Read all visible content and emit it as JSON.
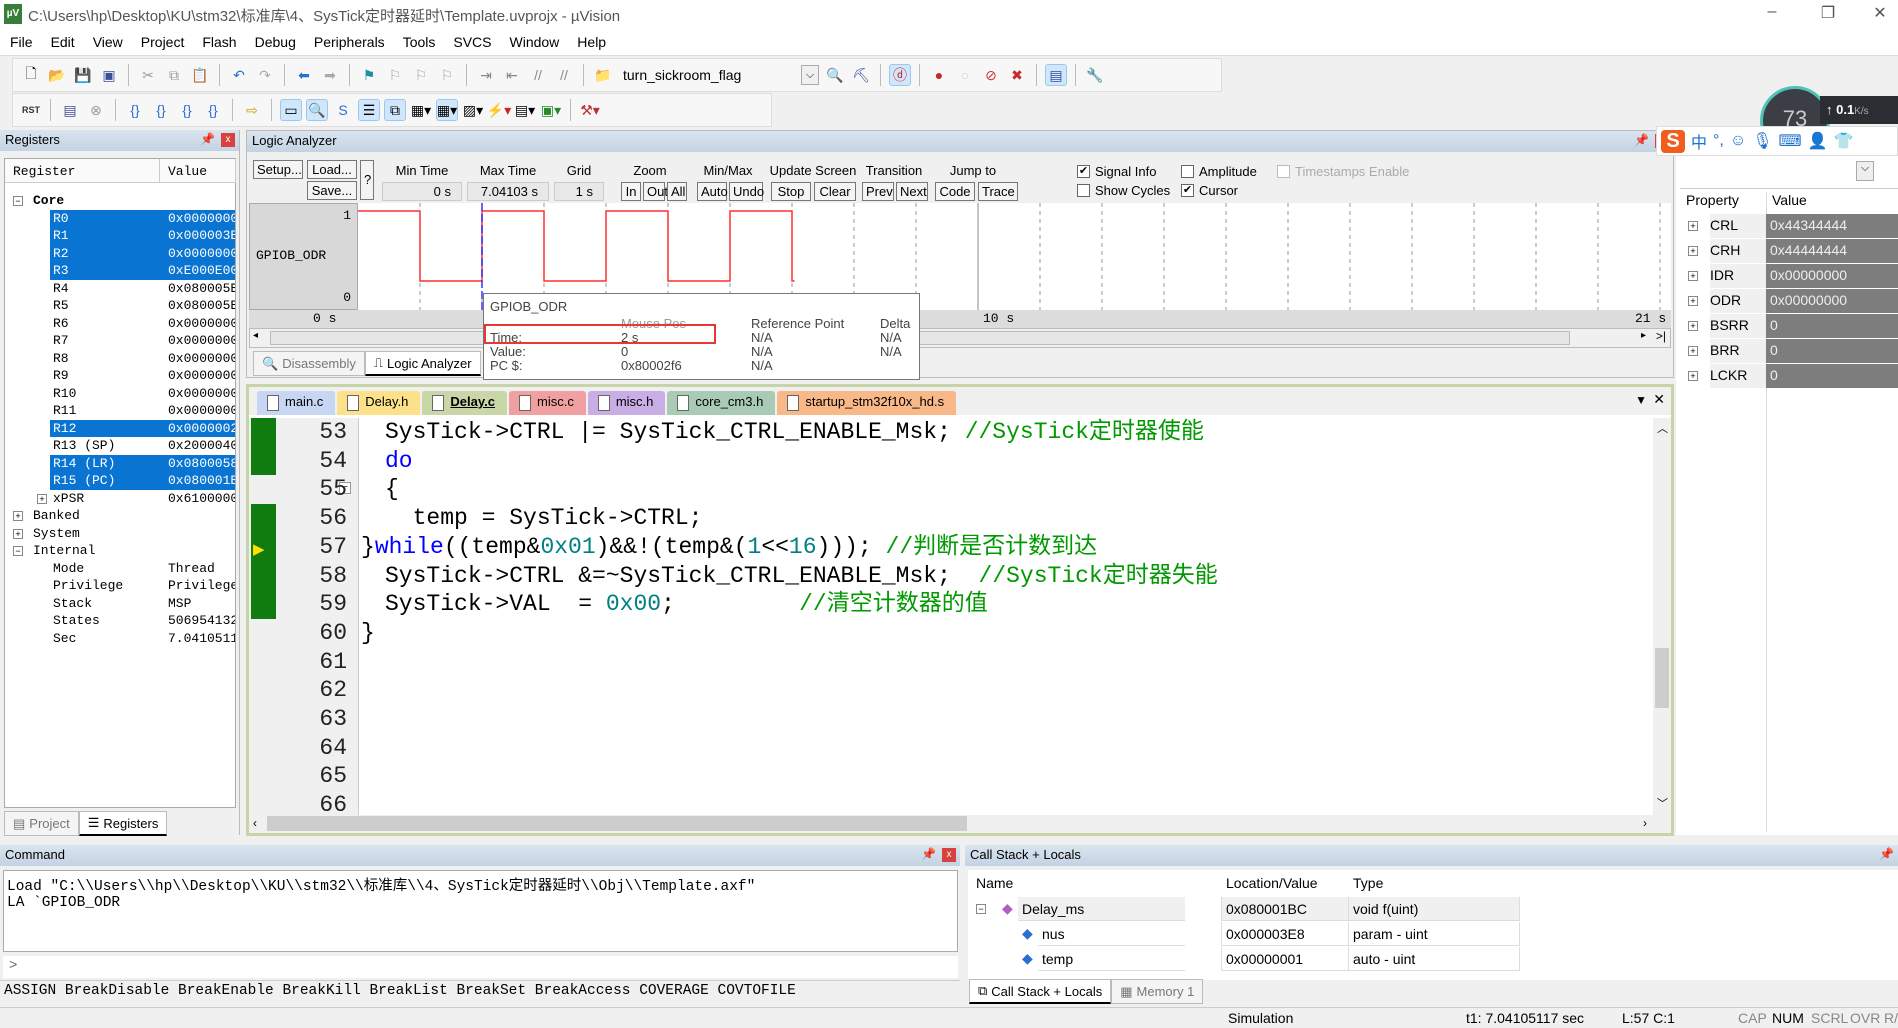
{
  "window": {
    "title": "C:\\Users\\hp\\Desktop\\KU\\stm32\\标准库\\4、SysTick定时器延时\\Template.uvprojx - µVision",
    "app_icon": "uv"
  },
  "menu": [
    "File",
    "Edit",
    "View",
    "Project",
    "Flash",
    "Debug",
    "Peripherals",
    "Tools",
    "SVCS",
    "Window",
    "Help"
  ],
  "toolbar": {
    "find_value": "turn_sickroom_flag",
    "rst_label": "RST"
  },
  "registers": {
    "title": "Registers",
    "col_register": "Register",
    "col_value": "Value",
    "rows": [
      {
        "name": "Core",
        "value": "",
        "level": 0,
        "toggle": "−",
        "bold": true,
        "sel": false
      },
      {
        "name": "R0",
        "value": "0x0000000",
        "level": 1,
        "sel": true
      },
      {
        "name": "R1",
        "value": "0x000003E",
        "level": 1,
        "sel": true
      },
      {
        "name": "R2",
        "value": "0x0000000",
        "level": 1,
        "sel": true
      },
      {
        "name": "R3",
        "value": "0xE000E00",
        "level": 1,
        "sel": true
      },
      {
        "name": "R4",
        "value": "0x080005B",
        "level": 1,
        "sel": false
      },
      {
        "name": "R5",
        "value": "0x080005B",
        "level": 1,
        "sel": false
      },
      {
        "name": "R6",
        "value": "0x0000000",
        "level": 1,
        "sel": false
      },
      {
        "name": "R7",
        "value": "0x0000000",
        "level": 1,
        "sel": false
      },
      {
        "name": "R8",
        "value": "0x0000000",
        "level": 1,
        "sel": false
      },
      {
        "name": "R9",
        "value": "0x0000000",
        "level": 1,
        "sel": false
      },
      {
        "name": "R10",
        "value": "0x0000000",
        "level": 1,
        "sel": false
      },
      {
        "name": "R11",
        "value": "0x0000000",
        "level": 1,
        "sel": false
      },
      {
        "name": "R12",
        "value": "0x0000002",
        "level": 1,
        "sel": true
      },
      {
        "name": "R13 (SP)",
        "value": "0x2000040",
        "level": 1,
        "sel": false
      },
      {
        "name": "R14 (LR)",
        "value": "0x0800058",
        "level": 1,
        "sel": true
      },
      {
        "name": "R15 (PC)",
        "value": "0x080001B",
        "level": 1,
        "sel": true
      },
      {
        "name": "xPSR",
        "value": "0x6100000",
        "level": 1,
        "toggle": "+",
        "sel": false
      },
      {
        "name": "Banked",
        "value": "",
        "level": 0,
        "toggle": "+",
        "sel": false
      },
      {
        "name": "System",
        "value": "",
        "level": 0,
        "toggle": "+",
        "sel": false
      },
      {
        "name": "Internal",
        "value": "",
        "level": 0,
        "toggle": "−",
        "sel": false
      },
      {
        "name": "Mode",
        "value": "Thread",
        "level": 1,
        "sel": false
      },
      {
        "name": "Privilege",
        "value": "Privilege",
        "level": 1,
        "sel": false
      },
      {
        "name": "Stack",
        "value": "MSP",
        "level": 1,
        "sel": false
      },
      {
        "name": "States",
        "value": "506954132",
        "level": 1,
        "sel": false
      },
      {
        "name": "Sec",
        "value": "7.0410511",
        "level": 1,
        "sel": false
      }
    ],
    "tabs": [
      {
        "label": "Project",
        "active": false
      },
      {
        "label": "Registers",
        "active": true
      }
    ]
  },
  "logic_analyzer": {
    "title": "Logic Analyzer",
    "setup": "Setup...",
    "load": "Load...",
    "save": "Save...",
    "help": "?",
    "min_time_label": "Min Time",
    "min_time": "0 s",
    "max_time_label": "Max Time",
    "max_time": "7.04103 s",
    "grid_label": "Grid",
    "grid": "1 s",
    "zoom_label": "Zoom",
    "zoom_in": "In",
    "zoom_out": "Out",
    "zoom_all": "All",
    "minmax_label": "Min/Max",
    "auto": "Auto",
    "undo": "Undo",
    "update_label": "Update Screen",
    "stop": "Stop",
    "clear": "Clear",
    "transition_label": "Transition",
    "prev": "Prev",
    "next": "Next",
    "jump_label": "Jump to",
    "code": "Code",
    "trace": "Trace",
    "signal_info": {
      "label": "Signal Info",
      "checked": true
    },
    "show_cycles": {
      "label": "Show Cycles",
      "checked": false
    },
    "amplitude": {
      "label": "Amplitude",
      "checked": false
    },
    "cursor": {
      "label": "Cursor",
      "checked": true
    },
    "timestamps": {
      "label": "Timestamps Enable",
      "checked": false,
      "disabled": true
    },
    "signal_name": "GPIOB_ODR",
    "y_high": "1",
    "y_low": "0",
    "axis_start": "0 s",
    "axis_mid": "10 s",
    "axis_end": "21 s",
    "signal_transitions_s": [
      [
        0,
        1
      ],
      [
        1,
        0
      ],
      [
        2,
        1
      ],
      [
        3,
        0
      ],
      [
        4,
        1
      ],
      [
        5,
        0
      ],
      [
        6,
        1
      ],
      [
        7,
        0
      ],
      [
        7.04103,
        0
      ]
    ],
    "cursor_s": 2,
    "trace_color": "#ff3030",
    "bottom_tabs": [
      {
        "label": "Disassembly",
        "active": false
      },
      {
        "label": "Logic Analyzer",
        "active": true
      }
    ],
    "tooltip": {
      "signal": "GPIOB_ODR",
      "col_mouse": "Mouse Pos",
      "col_ref": "Reference Point",
      "col_delta": "Delta",
      "rows": [
        {
          "label": "Time:",
          "mouse": "2 s",
          "ref": "N/A",
          "delta": "N/A"
        },
        {
          "label": "Value:",
          "mouse": "0",
          "ref": "N/A",
          "delta": "N/A"
        },
        {
          "label": "PC $:",
          "mouse": "0x80002f6",
          "ref": "N/A",
          "delta": ""
        }
      ]
    }
  },
  "editor": {
    "tabs": [
      {
        "label": "main.c",
        "color": "#c7d6f2",
        "active": false
      },
      {
        "label": "Delay.h",
        "color": "#fde08a",
        "active": false
      },
      {
        "label": "Delay.c",
        "color": "#c8d6a8",
        "active": true
      },
      {
        "label": "misc.c",
        "color": "#f0a0a0",
        "active": false
      },
      {
        "label": "misc.h",
        "color": "#c9aee6",
        "active": false
      },
      {
        "label": "core_cm3.h",
        "color": "#a9cbb6",
        "active": false
      },
      {
        "label": "startup_stm32f10x_hd.s",
        "color": "#f8b888",
        "active": false
      }
    ],
    "current_line": 57,
    "lines": [
      {
        "n": "53",
        "tokens": [
          {
            "t": "SysTick->CTRL |= SysTick_CTRL_ENABLE_Msk; ",
            "c": ""
          },
          {
            "t": "//SysTick定时器使能",
            "c": "cm"
          }
        ]
      },
      {
        "n": "54",
        "tokens": [
          {
            "t": "do",
            "c": "kw"
          }
        ]
      },
      {
        "n": "55",
        "tokens": [
          {
            "t": "{",
            "c": ""
          }
        ]
      },
      {
        "n": "56",
        "tokens": [
          {
            "t": "  temp = SysTick->CTRL;",
            "c": ""
          }
        ]
      },
      {
        "n": "57",
        "tokens": [
          {
            "t": "}",
            "c": ""
          },
          {
            "t": "while",
            "c": "kw"
          },
          {
            "t": "((temp&",
            "c": ""
          },
          {
            "t": "0x01",
            "c": "num"
          },
          {
            "t": ")&&!(temp&(",
            "c": ""
          },
          {
            "t": "1",
            "c": "num"
          },
          {
            "t": "<<",
            "c": ""
          },
          {
            "t": "16",
            "c": "num"
          },
          {
            "t": "))); ",
            "c": ""
          },
          {
            "t": "//判断是否计数到达",
            "c": "cm"
          }
        ]
      },
      {
        "n": "58",
        "tokens": [
          {
            "t": "SysTick->CTRL &=~SysTick_CTRL_ENABLE_Msk;  ",
            "c": ""
          },
          {
            "t": "//SysTick定时器失能",
            "c": "cm"
          }
        ]
      },
      {
        "n": "59",
        "tokens": [
          {
            "t": "SysTick->VAL  = ",
            "c": ""
          },
          {
            "t": "0x00",
            "c": "num"
          },
          {
            "t": ";         ",
            "c": ""
          },
          {
            "t": "//清空计数器的值",
            "c": "cm"
          }
        ]
      },
      {
        "n": "60",
        "tokens": [
          {
            "t": "}",
            "c": ""
          }
        ]
      },
      {
        "n": "61",
        "tokens": []
      },
      {
        "n": "62",
        "tokens": []
      },
      {
        "n": "63",
        "tokens": []
      },
      {
        "n": "64",
        "tokens": []
      },
      {
        "n": "65",
        "tokens": []
      },
      {
        "n": "66",
        "tokens": []
      }
    ]
  },
  "properties": {
    "col_property": "Property",
    "col_value": "Value",
    "rows": [
      {
        "name": "CRL",
        "value": "0x44344444"
      },
      {
        "name": "CRH",
        "value": "0x44444444"
      },
      {
        "name": "IDR",
        "value": "0x00000000"
      },
      {
        "name": "ODR",
        "value": "0x00000000"
      },
      {
        "name": "BSRR",
        "value": "0"
      },
      {
        "name": "BRR",
        "value": "0"
      },
      {
        "name": "LCKR",
        "value": "0"
      }
    ]
  },
  "command": {
    "title": "Command",
    "output": [
      "Load \"C:\\\\Users\\\\hp\\\\Desktop\\\\KU\\\\stm32\\\\标准库\\\\4、SysTick定时器延时\\\\Obj\\\\Template.axf\"",
      "LA `GPIOB_ODR"
    ],
    "prompt": ">",
    "commands": "ASSIGN BreakDisable BreakEnable BreakKill BreakList BreakSet BreakAccess COVERAGE COVTOFILE"
  },
  "callstack": {
    "title": "Call Stack + Locals",
    "col_name": "Name",
    "col_location": "Location/Value",
    "col_type": "Type",
    "rows": [
      {
        "name": "Delay_ms",
        "value": "0x080001BC",
        "type": "void f(uint)"
      },
      {
        "name": "nus",
        "value": "0x000003E8",
        "type": "param - uint"
      },
      {
        "name": "temp",
        "value": "0x00000001",
        "type": "auto - uint"
      }
    ],
    "tabs": [
      {
        "label": "Call Stack + Locals",
        "active": true
      },
      {
        "label": "Memory 1",
        "active": false
      }
    ]
  },
  "statusbar": {
    "mode": "Simulation",
    "time": "t1: 7.04105117 sec",
    "position": "L:57 C:1",
    "cap": "CAP",
    "num": "NUM",
    "scrl": "SCRL",
    "ovr": "OVR",
    "rw": "R/W"
  },
  "overlay": {
    "ime_logo": "S",
    "ime_lang": "中",
    "ime_punct": "°,",
    "gauge_value": "73",
    "net_speed": "0.1",
    "net_unit": "K/s"
  }
}
